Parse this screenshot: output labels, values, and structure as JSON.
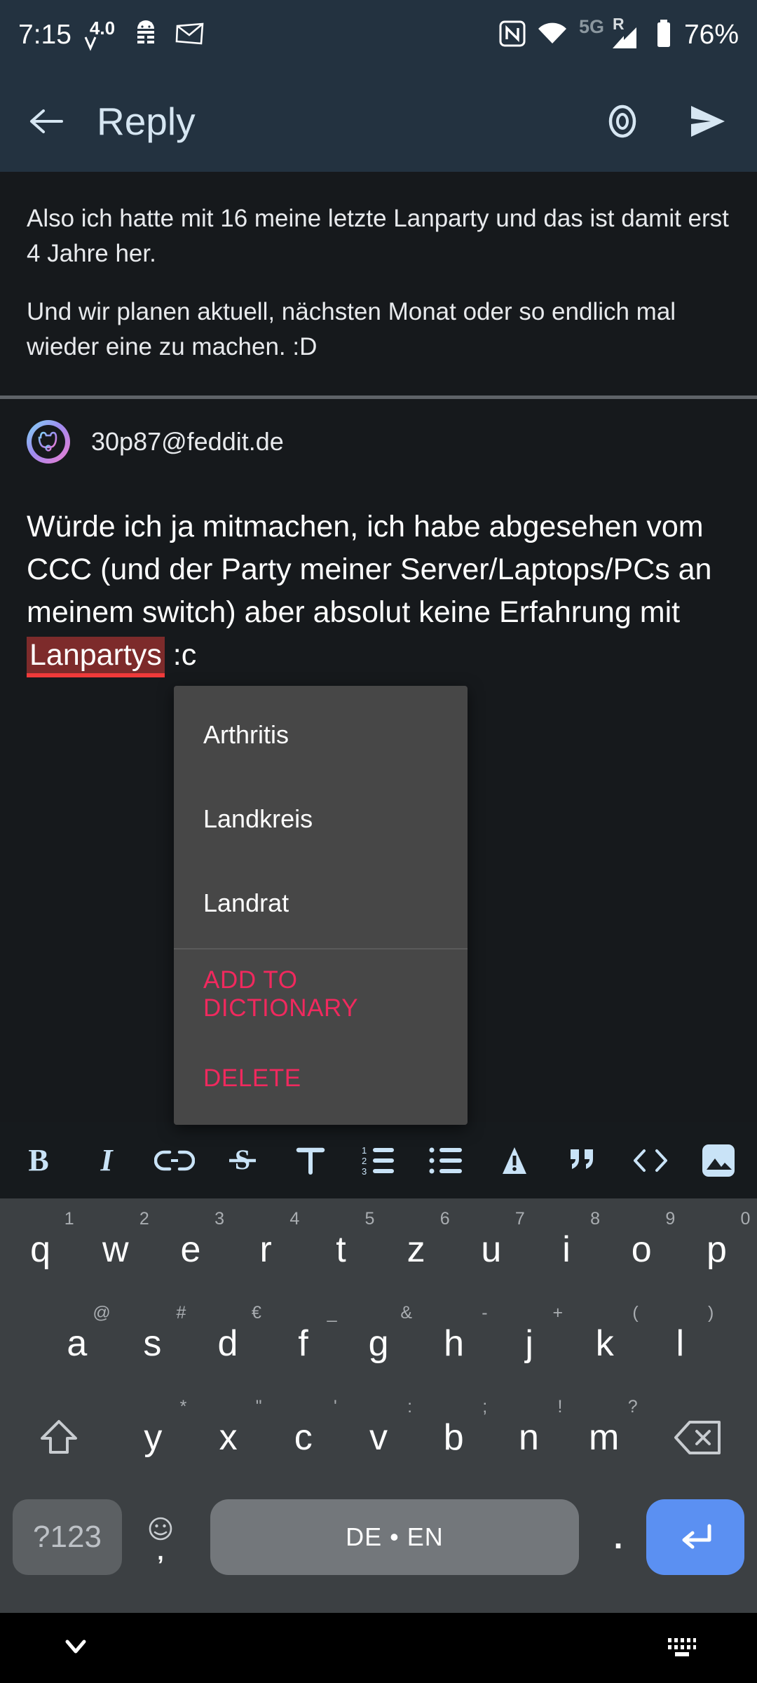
{
  "statusbar": {
    "time": "7:15",
    "battery_percent": "76%",
    "network_label": "5G",
    "roaming_label": "R",
    "icons": [
      "nfc-icon",
      "wifi-icon",
      "signal-icon",
      "battery-icon",
      "android-debug-icon",
      "mail-icon",
      "volume-4-icon"
    ],
    "volume_label": "4.0"
  },
  "appbar": {
    "title": "Reply",
    "back_label": "Back",
    "preview_label": "Preview",
    "send_label": "Send"
  },
  "quoted_message": {
    "paragraphs": [
      "Also ich hatte mit 16 meine letzte Lanparty und das ist damit erst 4 Jahre her.",
      "Und wir planen aktuell, nächsten Monat oder so endlich mal wieder eine zu machen. :D"
    ]
  },
  "author": {
    "name": "30p87@feddit.de"
  },
  "reply": {
    "text_before": "Würde ich ja mitmachen, ich habe abgesehen vom CCC (und der Party meiner Server/Laptops/PCs an meinem switch) aber absolut keine Erfahrung mit ",
    "misspelled_word": "Lanpartys",
    "text_after": " :c"
  },
  "suggestion_popup": {
    "suggestions": [
      "Arthritis",
      "Landkreis",
      "Landrat"
    ],
    "actions": [
      "ADD TO DICTIONARY",
      "DELETE"
    ],
    "action_color": "#f0295e"
  },
  "format_toolbar": {
    "buttons": [
      {
        "name": "bold-icon",
        "label": "B"
      },
      {
        "name": "italic-icon",
        "label": "I"
      },
      {
        "name": "link-icon",
        "label": "Link"
      },
      {
        "name": "strikethrough-icon",
        "label": "Strikethrough"
      },
      {
        "name": "text-format-icon",
        "label": "T"
      },
      {
        "name": "ordered-list-icon",
        "label": "Numbered list"
      },
      {
        "name": "bullet-list-icon",
        "label": "Bullet list"
      },
      {
        "name": "spoiler-icon",
        "label": "Spoiler"
      },
      {
        "name": "quote-icon",
        "label": "Quote"
      },
      {
        "name": "code-icon",
        "label": "Code"
      },
      {
        "name": "image-icon",
        "label": "Image"
      }
    ],
    "accent_color": "#c9e3f7"
  },
  "keyboard": {
    "row1": [
      {
        "key": "q",
        "hint": "1"
      },
      {
        "key": "w",
        "hint": "2"
      },
      {
        "key": "e",
        "hint": "3"
      },
      {
        "key": "r",
        "hint": "4"
      },
      {
        "key": "t",
        "hint": "5"
      },
      {
        "key": "z",
        "hint": "6"
      },
      {
        "key": "u",
        "hint": "7"
      },
      {
        "key": "i",
        "hint": "8"
      },
      {
        "key": "o",
        "hint": "9"
      },
      {
        "key": "p",
        "hint": "0"
      }
    ],
    "row2": [
      {
        "key": "a",
        "hint": "@"
      },
      {
        "key": "s",
        "hint": "#"
      },
      {
        "key": "d",
        "hint": "€"
      },
      {
        "key": "f",
        "hint": "_"
      },
      {
        "key": "g",
        "hint": "&"
      },
      {
        "key": "h",
        "hint": "-"
      },
      {
        "key": "j",
        "hint": "+"
      },
      {
        "key": "k",
        "hint": "("
      },
      {
        "key": "l",
        "hint": ")"
      }
    ],
    "row3": [
      {
        "key": "y",
        "hint": "*"
      },
      {
        "key": "x",
        "hint": "\""
      },
      {
        "key": "c",
        "hint": "'"
      },
      {
        "key": "v",
        "hint": ":"
      },
      {
        "key": "b",
        "hint": ";"
      },
      {
        "key": "n",
        "hint": "!"
      },
      {
        "key": "m",
        "hint": "?"
      }
    ],
    "symbols_key": "?123",
    "comma_key": ",",
    "space_label": "DE • EN",
    "period_key": ".",
    "enter_label": "Enter",
    "shift_label": "Shift",
    "backspace_label": "Backspace",
    "enter_color": "#5b90f2"
  },
  "navbar": {
    "hide_keyboard_label": "Hide keyboard",
    "switch_keyboard_label": "Switch keyboard"
  }
}
